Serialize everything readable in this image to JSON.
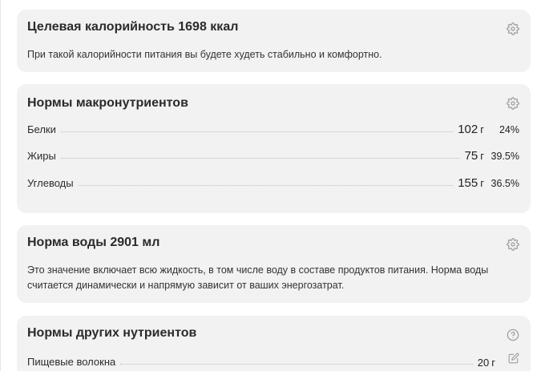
{
  "calorie_card": {
    "title": "Целевая калорийность 1698 ккал",
    "description": "При такой калорийности питания вы будете худеть стабильно и комфортно.",
    "icon": "gear-icon"
  },
  "macros_card": {
    "title": "Нормы макронутриентов",
    "icon": "gear-icon",
    "rows": [
      {
        "label": "Белки",
        "value": "102",
        "unit": "г",
        "percent": "24%"
      },
      {
        "label": "Жиры",
        "value": "75",
        "unit": "г",
        "percent": "39.5%"
      },
      {
        "label": "Углеводы",
        "value": "155",
        "unit": "г",
        "percent": "36.5%"
      }
    ]
  },
  "water_card": {
    "title": "Норма воды 2901 мл",
    "description": "Это значение включает всю жидкость, в том числе воду в составе продуктов питания. Норма воды считается динамически и напрямую зависит от ваших энергозатрат.",
    "icon": "gear-icon"
  },
  "other_card": {
    "title": "Нормы других нутриентов",
    "icon": "help-circle-icon",
    "rows": [
      {
        "label": "Пищевые волокна",
        "value": "20",
        "unit": "г",
        "icon": "edit-icon"
      }
    ]
  },
  "colors": {
    "card_bg": "#f2f2f2",
    "icon": "#9a9a9a",
    "text": "#222222"
  }
}
